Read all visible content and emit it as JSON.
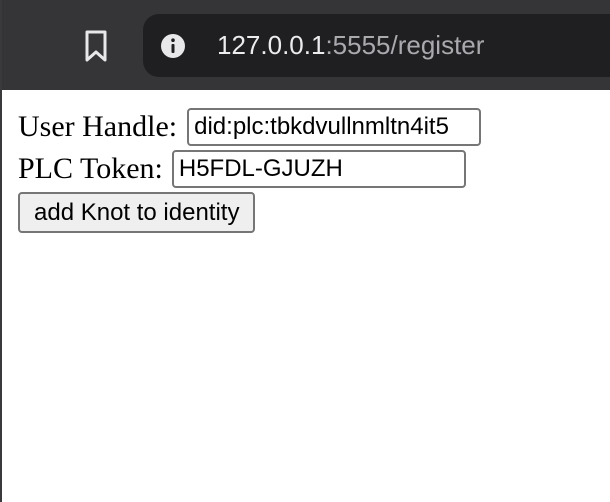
{
  "browser": {
    "url_host": "127.0.0.1",
    "url_rest": ":5555/register",
    "bookmark_icon": "bookmark-icon",
    "info_icon": "info-icon",
    "toolbar_color": "#353538",
    "urlbar_color": "#1f1f21"
  },
  "form": {
    "handle_label": "User Handle:",
    "handle_value": "did:plc:tbkdvullnmltn4it5",
    "token_label": "PLC Token:",
    "token_value": "H5FDL-GJUZH",
    "submit_label": "add Knot to identity"
  }
}
